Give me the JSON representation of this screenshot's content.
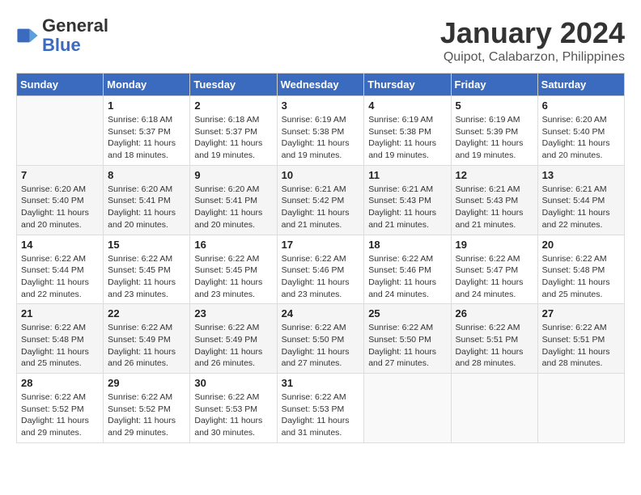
{
  "header": {
    "logo_line1": "General",
    "logo_line2": "Blue",
    "month_title": "January 2024",
    "subtitle": "Quipot, Calabarzon, Philippines"
  },
  "days_of_week": [
    "Sunday",
    "Monday",
    "Tuesday",
    "Wednesday",
    "Thursday",
    "Friday",
    "Saturday"
  ],
  "weeks": [
    [
      {
        "day": "",
        "info": ""
      },
      {
        "day": "1",
        "info": "Sunrise: 6:18 AM\nSunset: 5:37 PM\nDaylight: 11 hours\nand 18 minutes."
      },
      {
        "day": "2",
        "info": "Sunrise: 6:18 AM\nSunset: 5:37 PM\nDaylight: 11 hours\nand 19 minutes."
      },
      {
        "day": "3",
        "info": "Sunrise: 6:19 AM\nSunset: 5:38 PM\nDaylight: 11 hours\nand 19 minutes."
      },
      {
        "day": "4",
        "info": "Sunrise: 6:19 AM\nSunset: 5:38 PM\nDaylight: 11 hours\nand 19 minutes."
      },
      {
        "day": "5",
        "info": "Sunrise: 6:19 AM\nSunset: 5:39 PM\nDaylight: 11 hours\nand 19 minutes."
      },
      {
        "day": "6",
        "info": "Sunrise: 6:20 AM\nSunset: 5:40 PM\nDaylight: 11 hours\nand 20 minutes."
      }
    ],
    [
      {
        "day": "7",
        "info": "Sunrise: 6:20 AM\nSunset: 5:40 PM\nDaylight: 11 hours\nand 20 minutes."
      },
      {
        "day": "8",
        "info": "Sunrise: 6:20 AM\nSunset: 5:41 PM\nDaylight: 11 hours\nand 20 minutes."
      },
      {
        "day": "9",
        "info": "Sunrise: 6:20 AM\nSunset: 5:41 PM\nDaylight: 11 hours\nand 20 minutes."
      },
      {
        "day": "10",
        "info": "Sunrise: 6:21 AM\nSunset: 5:42 PM\nDaylight: 11 hours\nand 21 minutes."
      },
      {
        "day": "11",
        "info": "Sunrise: 6:21 AM\nSunset: 5:43 PM\nDaylight: 11 hours\nand 21 minutes."
      },
      {
        "day": "12",
        "info": "Sunrise: 6:21 AM\nSunset: 5:43 PM\nDaylight: 11 hours\nand 21 minutes."
      },
      {
        "day": "13",
        "info": "Sunrise: 6:21 AM\nSunset: 5:44 PM\nDaylight: 11 hours\nand 22 minutes."
      }
    ],
    [
      {
        "day": "14",
        "info": "Sunrise: 6:22 AM\nSunset: 5:44 PM\nDaylight: 11 hours\nand 22 minutes."
      },
      {
        "day": "15",
        "info": "Sunrise: 6:22 AM\nSunset: 5:45 PM\nDaylight: 11 hours\nand 23 minutes."
      },
      {
        "day": "16",
        "info": "Sunrise: 6:22 AM\nSunset: 5:45 PM\nDaylight: 11 hours\nand 23 minutes."
      },
      {
        "day": "17",
        "info": "Sunrise: 6:22 AM\nSunset: 5:46 PM\nDaylight: 11 hours\nand 23 minutes."
      },
      {
        "day": "18",
        "info": "Sunrise: 6:22 AM\nSunset: 5:46 PM\nDaylight: 11 hours\nand 24 minutes."
      },
      {
        "day": "19",
        "info": "Sunrise: 6:22 AM\nSunset: 5:47 PM\nDaylight: 11 hours\nand 24 minutes."
      },
      {
        "day": "20",
        "info": "Sunrise: 6:22 AM\nSunset: 5:48 PM\nDaylight: 11 hours\nand 25 minutes."
      }
    ],
    [
      {
        "day": "21",
        "info": "Sunrise: 6:22 AM\nSunset: 5:48 PM\nDaylight: 11 hours\nand 25 minutes."
      },
      {
        "day": "22",
        "info": "Sunrise: 6:22 AM\nSunset: 5:49 PM\nDaylight: 11 hours\nand 26 minutes."
      },
      {
        "day": "23",
        "info": "Sunrise: 6:22 AM\nSunset: 5:49 PM\nDaylight: 11 hours\nand 26 minutes."
      },
      {
        "day": "24",
        "info": "Sunrise: 6:22 AM\nSunset: 5:50 PM\nDaylight: 11 hours\nand 27 minutes."
      },
      {
        "day": "25",
        "info": "Sunrise: 6:22 AM\nSunset: 5:50 PM\nDaylight: 11 hours\nand 27 minutes."
      },
      {
        "day": "26",
        "info": "Sunrise: 6:22 AM\nSunset: 5:51 PM\nDaylight: 11 hours\nand 28 minutes."
      },
      {
        "day": "27",
        "info": "Sunrise: 6:22 AM\nSunset: 5:51 PM\nDaylight: 11 hours\nand 28 minutes."
      }
    ],
    [
      {
        "day": "28",
        "info": "Sunrise: 6:22 AM\nSunset: 5:52 PM\nDaylight: 11 hours\nand 29 minutes."
      },
      {
        "day": "29",
        "info": "Sunrise: 6:22 AM\nSunset: 5:52 PM\nDaylight: 11 hours\nand 29 minutes."
      },
      {
        "day": "30",
        "info": "Sunrise: 6:22 AM\nSunset: 5:53 PM\nDaylight: 11 hours\nand 30 minutes."
      },
      {
        "day": "31",
        "info": "Sunrise: 6:22 AM\nSunset: 5:53 PM\nDaylight: 11 hours\nand 31 minutes."
      },
      {
        "day": "",
        "info": ""
      },
      {
        "day": "",
        "info": ""
      },
      {
        "day": "",
        "info": ""
      }
    ]
  ]
}
